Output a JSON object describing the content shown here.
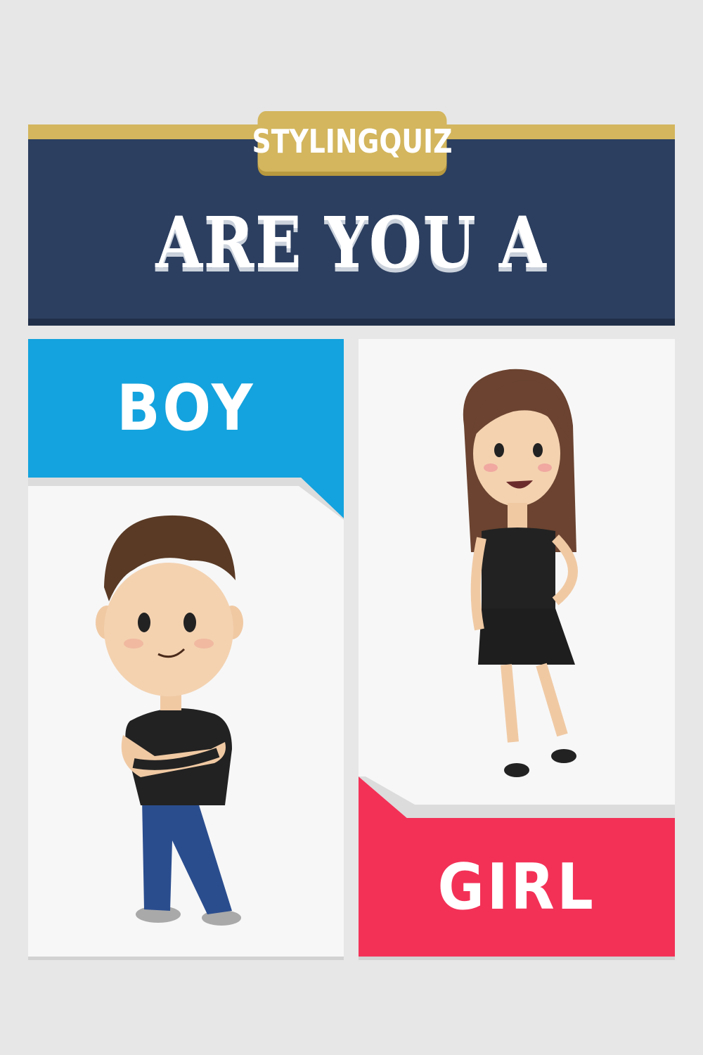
{
  "brand": "STYLINGQUIZ",
  "title": "ARE YOU A",
  "options": [
    {
      "label": "BOY",
      "color": "#14a3de",
      "icon": "boy-illustration-icon"
    },
    {
      "label": "GIRL",
      "color": "#f33157",
      "icon": "girl-illustration-icon"
    }
  ],
  "colors": {
    "background": "#e7e7e7",
    "header": "#2c3f60",
    "gold": "#d3b65e",
    "card": "#f7f7f7"
  }
}
